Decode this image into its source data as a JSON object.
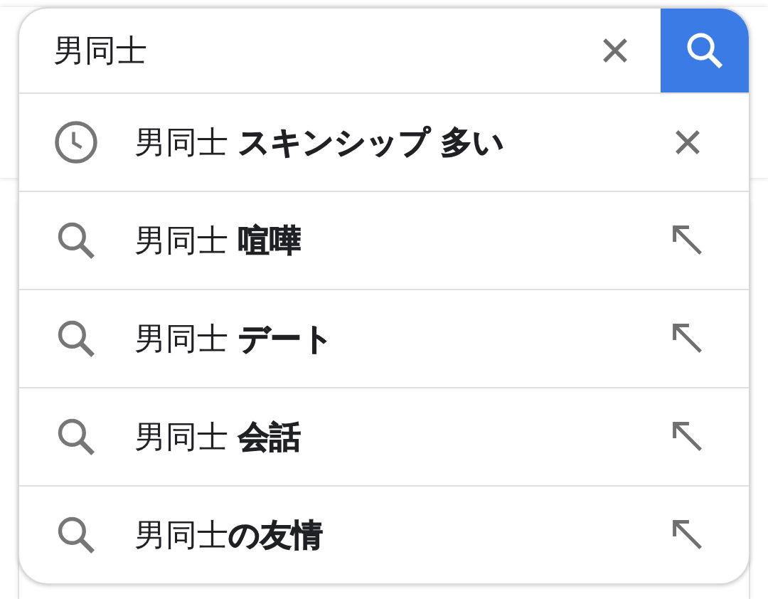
{
  "search": {
    "value": "男同士"
  },
  "suggestions": [
    {
      "kind": "history",
      "text": "男同士 **スキンシップ 多い**"
    },
    {
      "kind": "query",
      "text": "男同士 **喧嘩**"
    },
    {
      "kind": "query",
      "text": "男同士 **デート**"
    },
    {
      "kind": "query",
      "text": "男同士 **会話**"
    },
    {
      "kind": "query",
      "text": "男同士**の友情**"
    }
  ]
}
